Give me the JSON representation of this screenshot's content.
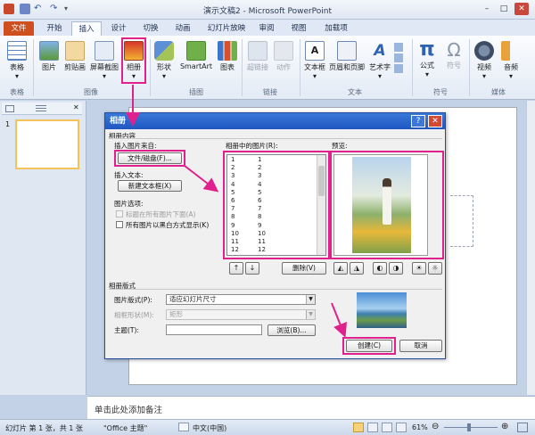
{
  "window": {
    "title": "演示文稿2 - Microsoft PowerPoint"
  },
  "tabs": [
    "文件",
    "开始",
    "插入",
    "设计",
    "切换",
    "动画",
    "幻灯片放映",
    "审阅",
    "视图",
    "加载项"
  ],
  "ribbon": {
    "groups": {
      "table": "表格",
      "images": "图像",
      "illustrations": "插图",
      "links": "链接",
      "text": "文本",
      "symbols": "符号",
      "media": "媒体"
    },
    "buttons": {
      "table": "表格",
      "picture": "图片",
      "clipart": "剪贴画",
      "screenshot": "屏幕截图",
      "album": "相册",
      "shapes": "形状",
      "smartart": "SmartArt",
      "chart": "图表",
      "hyperlink": "超链接",
      "action": "动作",
      "textbox": "文本框",
      "header_footer": "页眉和页脚",
      "wordart": "艺术字",
      "equation": "公式",
      "symbol": "符号",
      "video": "视频",
      "audio": "音频"
    }
  },
  "slide_thumb_number": "1",
  "notes_placeholder": "单击此处添加备注",
  "status": {
    "slide_info": "幻灯片 第 1 张，共 1 张",
    "theme": "\"Office 主题\"",
    "language": "中文(中国)",
    "zoom": "61%"
  },
  "dialog": {
    "title": "相册",
    "help": "?",
    "close": "✕",
    "album_content": "相册内容",
    "insert_picture_from": "插入图片来自:",
    "file_disk_button": "文件/磁盘(F)...",
    "insert_text": "插入文本:",
    "new_textbox_button": "新建文本框(X)",
    "picture_options": "图片选项:",
    "caption_below": "标题在所有图片下面(A)",
    "all_bw": "所有图片以黑白方式显示(K)",
    "pictures_in_album": "相册中的图片(R):",
    "picture_list": [
      [
        "1",
        "1"
      ],
      [
        "2",
        "2"
      ],
      [
        "3",
        "3"
      ],
      [
        "4",
        "4"
      ],
      [
        "5",
        "5"
      ],
      [
        "6",
        "6"
      ],
      [
        "7",
        "7"
      ],
      [
        "8",
        "8"
      ],
      [
        "9",
        "9"
      ],
      [
        "10",
        "10"
      ],
      [
        "11",
        "11"
      ],
      [
        "12",
        "12"
      ]
    ],
    "preview": "预览:",
    "up_button": "↑",
    "down_button": "↓",
    "remove_button": "删除(V)",
    "album_layout": "相册版式",
    "picture_layout_label": "图片版式(P):",
    "picture_layout_value": "适应幻灯片尺寸",
    "frame_shape_label": "相框形状(M):",
    "frame_shape_value": "矩形",
    "theme_label": "主题(T):",
    "theme_value": "",
    "browse_button": "浏览(B)...",
    "create_button": "创建(C)",
    "cancel_button": "取消"
  },
  "colors": {
    "highlight": "#e0208c",
    "file_tab": "#cf4f1e",
    "dialog_title": "#2a64cc"
  }
}
